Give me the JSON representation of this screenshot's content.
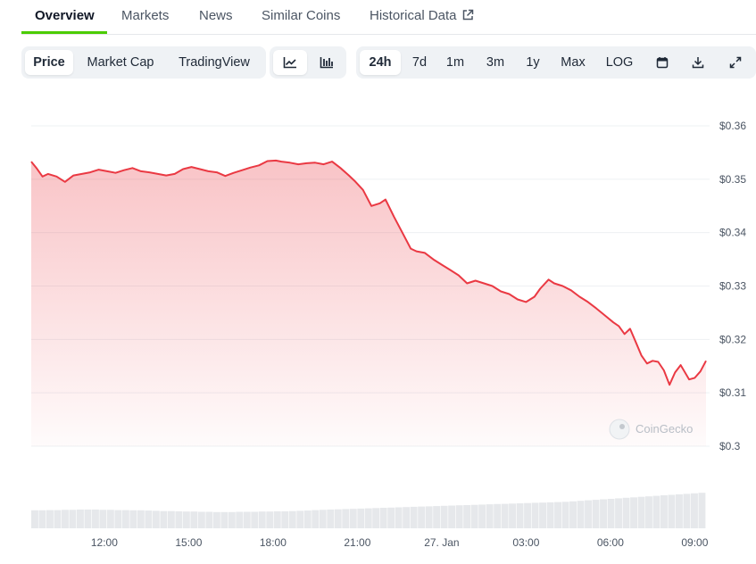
{
  "tabs": [
    {
      "label": "Overview",
      "active": true
    },
    {
      "label": "Markets"
    },
    {
      "label": "News"
    },
    {
      "label": "Similar Coins"
    },
    {
      "label": "Historical Data",
      "icon": "external-link-icon"
    }
  ],
  "chart_type_tabs": [
    {
      "label": "Price",
      "selected": true
    },
    {
      "label": "Market Cap"
    },
    {
      "label": "TradingView"
    }
  ],
  "view_toggle": [
    {
      "icon": "line-chart-icon",
      "selected": true
    },
    {
      "icon": "candlestick-chart-icon"
    }
  ],
  "range_tabs": [
    {
      "label": "24h",
      "selected": true
    },
    {
      "label": "7d"
    },
    {
      "label": "1m"
    },
    {
      "label": "3m"
    },
    {
      "label": "1y"
    },
    {
      "label": "Max"
    },
    {
      "label": "LOG"
    }
  ],
  "action_icons": [
    "calendar-icon",
    "download-icon",
    "fullscreen-icon"
  ],
  "watermark": "CoinGecko",
  "colors": {
    "line": "#ea3943",
    "accent": "#4bcc00",
    "volume": "#e5e7eb"
  },
  "chart_data": {
    "type": "area",
    "ylim": [
      0.3,
      0.36
    ],
    "y_ticks": [
      "$0.36",
      "$0.35",
      "$0.34",
      "$0.33",
      "$0.32",
      "$0.31",
      "$0.3"
    ],
    "y_tick_values": [
      0.36,
      0.35,
      0.34,
      0.33,
      0.32,
      0.31,
      0.3
    ],
    "x_ticks": [
      "12:00",
      "15:00",
      "18:00",
      "21:00",
      "27. Jan",
      "03:00",
      "06:00",
      "09:00"
    ],
    "x_tick_hours": [
      12,
      15,
      18,
      21,
      24,
      27,
      30,
      33
    ],
    "xlim_hours": [
      9.4,
      33.4
    ],
    "grid": true,
    "series": [
      {
        "x": [
          9.4,
          9.6,
          9.8,
          10.0,
          10.3,
          10.6,
          10.9,
          11.2,
          11.5,
          11.8,
          12.1,
          12.4,
          12.7,
          13.0,
          13.3,
          13.6,
          13.9,
          14.2,
          14.5,
          14.8,
          15.1,
          15.4,
          15.7,
          16.0,
          16.3,
          16.6,
          16.9,
          17.2,
          17.5,
          17.8,
          18.1,
          18.3,
          18.6,
          18.9,
          19.2,
          19.5,
          19.8,
          20.1,
          20.4,
          20.7,
          20.9,
          21.2,
          21.5,
          21.8,
          22.0,
          22.3,
          22.6,
          22.9,
          23.1,
          23.4,
          23.7,
          24.0,
          24.3,
          24.6,
          24.9,
          25.2,
          25.5,
          25.8,
          26.1,
          26.4,
          26.7,
          27.0,
          27.3,
          27.5,
          27.8,
          28.0,
          28.3,
          28.6,
          28.9,
          29.2,
          29.5,
          29.8,
          30.1,
          30.3,
          30.5,
          30.7,
          30.9,
          31.1,
          31.3,
          31.5,
          31.7,
          31.9,
          32.1,
          32.3,
          32.5,
          32.8,
          33.0,
          33.2,
          33.4
        ],
        "y": [
          0.3533,
          0.352,
          0.3505,
          0.351,
          0.3505,
          0.3495,
          0.3507,
          0.351,
          0.3513,
          0.3518,
          0.3515,
          0.3512,
          0.3517,
          0.3521,
          0.3515,
          0.3513,
          0.351,
          0.3507,
          0.351,
          0.3519,
          0.3523,
          0.3519,
          0.3515,
          0.3513,
          0.3506,
          0.3512,
          0.3517,
          0.3522,
          0.3526,
          0.3534,
          0.3535,
          0.3533,
          0.3531,
          0.3528,
          0.353,
          0.3531,
          0.3528,
          0.3533,
          0.3521,
          0.3507,
          0.3497,
          0.348,
          0.345,
          0.3455,
          0.3462,
          0.343,
          0.34,
          0.337,
          0.3365,
          0.3362,
          0.335,
          0.334,
          0.333,
          0.332,
          0.3305,
          0.331,
          0.3305,
          0.33,
          0.329,
          0.3285,
          0.3275,
          0.327,
          0.328,
          0.3295,
          0.3312,
          0.3305,
          0.33,
          0.3292,
          0.328,
          0.327,
          0.3258,
          0.3245,
          0.3232,
          0.3225,
          0.321,
          0.322,
          0.3195,
          0.317,
          0.3155,
          0.316,
          0.3158,
          0.3142,
          0.3115,
          0.3138,
          0.3152,
          0.3125,
          0.3128,
          0.314,
          0.316
        ]
      }
    ],
    "volume": [
      0.72,
      0.72,
      0.73,
      0.73,
      0.74,
      0.74,
      0.75,
      0.75,
      0.75,
      0.74,
      0.74,
      0.73,
      0.73,
      0.72,
      0.72,
      0.71,
      0.7,
      0.69,
      0.69,
      0.68,
      0.67,
      0.67,
      0.66,
      0.66,
      0.65,
      0.65,
      0.65,
      0.66,
      0.66,
      0.66,
      0.67,
      0.67,
      0.68,
      0.68,
      0.69,
      0.7,
      0.71,
      0.73,
      0.74,
      0.75,
      0.76,
      0.77,
      0.78,
      0.79,
      0.8,
      0.81,
      0.82,
      0.83,
      0.84,
      0.85,
      0.86,
      0.87,
      0.88,
      0.89,
      0.9,
      0.91,
      0.92,
      0.93,
      0.94,
      0.95,
      0.96,
      0.97,
      0.98,
      0.99,
      1.0,
      1.01,
      1.02,
      1.03,
      1.04,
      1.05,
      1.06,
      1.08,
      1.1,
      1.12,
      1.14,
      1.16,
      1.18,
      1.2,
      1.22,
      1.24,
      1.26,
      1.28,
      1.3,
      1.32,
      1.34,
      1.36,
      1.38,
      1.4,
      1.42
    ]
  }
}
